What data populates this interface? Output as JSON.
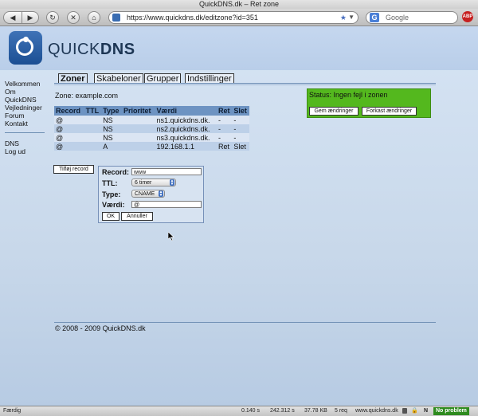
{
  "window": {
    "title": "QuickDNS.dk – Ret zone"
  },
  "browser": {
    "url": "https://www.quickdns.dk/editzone?id=351",
    "search_placeholder": "Google",
    "back_icon": "back-arrow",
    "forward_icon": "forward-arrow",
    "status_text": "Færdig",
    "status_items": [
      "0.140 s",
      "242.312 s",
      "37.78 KB",
      "5 req",
      "www.quickdns.dk"
    ],
    "no_problem": "No problem"
  },
  "site": {
    "logo_text_light": "QUICK",
    "logo_text_bold": "DNS"
  },
  "sidenav": {
    "primary": [
      "Velkommen",
      "Om QuickDNS",
      "Vejledninger",
      "Forum",
      "Kontakt"
    ],
    "secondary": [
      "DNS",
      "Log ud"
    ]
  },
  "tabs": [
    "Zoner",
    "Skabeloner",
    "Grupper",
    "Indstillinger"
  ],
  "zone_label": "Zone: example.com",
  "table": {
    "headers": [
      "Record",
      "TTL",
      "Type",
      "Prioritet",
      "Værdi",
      "Ret",
      "Slet"
    ],
    "rows": [
      [
        "@",
        "",
        "NS",
        "",
        "ns1.quickdns.dk.",
        "-",
        "-"
      ],
      [
        "@",
        "",
        "NS",
        "",
        "ns2.quickdns.dk.",
        "-",
        "-"
      ],
      [
        "@",
        "",
        "NS",
        "",
        "ns3.quickdns.dk.",
        "-",
        "-"
      ],
      [
        "@",
        "",
        "A",
        "",
        "192.168.1.1",
        "Ret",
        "Slet"
      ]
    ]
  },
  "status": {
    "text": "Status: Ingen fejl i zonen",
    "save_label": "Gem ændringer",
    "discard_label": "Forkast ændringer",
    "color": "#54b81e"
  },
  "add_record_label": "Tilføj record",
  "form": {
    "record_label": "Record:",
    "record_value": "www",
    "ttl_label": "TTL:",
    "ttl_value": "6 timer",
    "type_label": "Type:",
    "type_value": "CNAME",
    "value_label": "Værdi:",
    "value_value": "@",
    "ok_label": "OK",
    "cancel_label": "Annuller"
  },
  "footer": "© 2008 - 2009 QuickDNS.dk"
}
